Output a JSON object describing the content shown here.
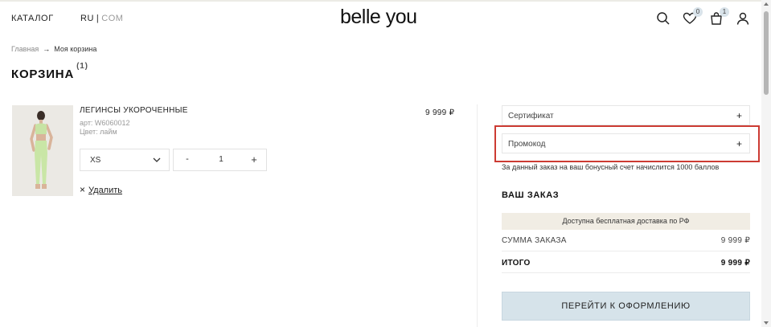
{
  "header": {
    "catalog_label": "КАТАЛОГ",
    "lang_active": "RU",
    "lang_sep": "|",
    "lang_inactive": "COM",
    "logo": "belle you",
    "favorites_count": "0",
    "cart_count": "1",
    "icons": [
      "search-icon",
      "heart-icon",
      "bag-icon",
      "user-icon"
    ]
  },
  "breadcrumb": {
    "home": "Главная",
    "arrow": "→",
    "current": "Моя корзина"
  },
  "page": {
    "title": "КОРЗИНА",
    "count": "(1)"
  },
  "product": {
    "name": "ЛЕГИНСЫ УКОРОЧЕННЫЕ",
    "article": "арт: W6060012",
    "color": "Цвет: лайм",
    "price": "9 999 ₽",
    "size": "XS",
    "quantity": "1",
    "minus": "-",
    "plus": "+",
    "delete_icon": "×",
    "delete_label": "Удалить"
  },
  "sidebar": {
    "certificate_label": "Сертификат",
    "promo_label": "Промокод",
    "plus": "+",
    "bonus_text": "За данный заказ на ваш бонусный счет начислится 1000 баллов",
    "order_title": "ВАШ ЗАКАЗ",
    "delivery_banner": "Доступна бесплатная доставка по РФ",
    "sum_label": "СУММА ЗАКАЗА",
    "sum_value": "9 999 ₽",
    "total_label": "ИТОГО",
    "total_value": "9 999 ₽",
    "checkout_label": "ПЕРЕЙТИ К ОФОРМЛЕНИЮ"
  },
  "colors": {
    "accent_button": "#d6e3ea",
    "banner": "#f1ede4",
    "highlight": "#cc3b33"
  }
}
